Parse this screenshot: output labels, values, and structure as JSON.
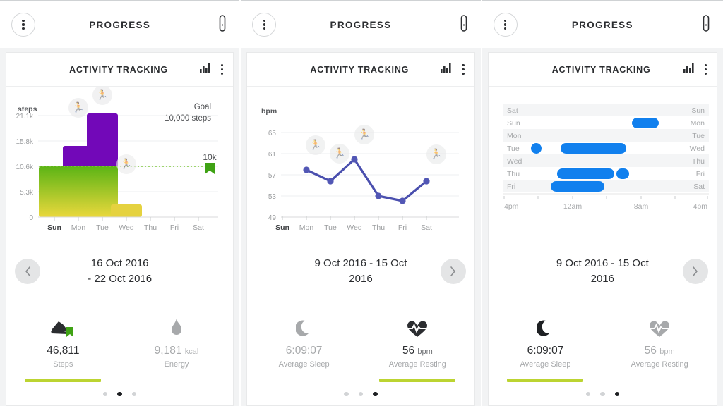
{
  "appbar": {
    "title": "PROGRESS",
    "menu_icon": "kebab-menu-icon",
    "band_icon": "fitness-band-icon"
  },
  "card": {
    "title": "ACTIVITY TRACKING",
    "chart_icon": "bar-chart-icon",
    "overflow_icon": "kebab-menu-icon"
  },
  "screens": [
    {
      "id": "steps",
      "date_range": "16 Oct 2016\n- 22 Oct 2016",
      "date_range_line1": "16 Oct 2016",
      "date_range_line2": "- 22 Oct 2016",
      "nav": {
        "prev_label": "‹",
        "show_prev": true,
        "show_next": false
      },
      "stats": [
        {
          "icon": "shoe-icon",
          "value": "46,811",
          "unit": "",
          "label": "Steps",
          "active": true,
          "goal_flag": true
        },
        {
          "icon": "flame-icon",
          "value": "9,181",
          "unit": "kcal",
          "label": "Energy",
          "active": false
        }
      ],
      "page_dots": [
        false,
        true,
        false
      ]
    },
    {
      "id": "heart-rate",
      "date_range_line1": "9 Oct 2016 - 15 Oct",
      "date_range_line2": "2016",
      "nav": {
        "next_label": "›",
        "show_prev": false,
        "show_next": true
      },
      "stats": [
        {
          "icon": "moon-icon",
          "value": "6:09:07",
          "unit": "",
          "label": "Average Sleep",
          "active": false
        },
        {
          "icon": "heart-pulse-icon",
          "value": "56",
          "unit": "bpm",
          "label": "Average Resting",
          "active": true
        }
      ],
      "page_dots": [
        false,
        false,
        true
      ]
    },
    {
      "id": "sleep",
      "date_range_line1": "9 Oct 2016 - 15 Oct",
      "date_range_line2": "2016",
      "nav": {
        "next_label": "›",
        "show_prev": false,
        "show_next": true
      },
      "stats": [
        {
          "icon": "moon-icon",
          "value": "6:09:07",
          "unit": "",
          "label": "Average Sleep",
          "active": true
        },
        {
          "icon": "heart-pulse-icon",
          "value": "56",
          "unit": "bpm",
          "label": "Average Resting",
          "active": false
        }
      ],
      "page_dots": [
        false,
        false,
        true
      ]
    }
  ],
  "chart_data": [
    {
      "type": "bar",
      "id": "steps-chart",
      "title": "",
      "ylabel": "steps",
      "xlabel": "",
      "categories": [
        "Sun",
        "Mon",
        "Tue",
        "Wed",
        "Thu",
        "Fri",
        "Sat"
      ],
      "values": [
        10400,
        13100,
        20100,
        2600,
        0,
        0,
        0
      ],
      "ytick_labels": [
        "0",
        "5.3k",
        "10.6k",
        "15.8k",
        "21.1k"
      ],
      "ytick_values": [
        0,
        5300,
        10600,
        15800,
        21100
      ],
      "ylim": [
        0,
        23000
      ],
      "grid": true,
      "bold_category": "Sun",
      "goal": {
        "value": 10000,
        "label": "10k",
        "title": "Goal",
        "subtitle": "10,000 steps",
        "color": "#3fa214"
      },
      "bar_color_top": "#5cb415",
      "bar_color_bottom": "#e8d93d",
      "over_goal_color": "#7208b8",
      "annotations": [
        {
          "icon": "running-pin-icon",
          "category": "Sun",
          "x_frac": 0.3,
          "y_value": 15500
        },
        {
          "icon": "running-pin-icon",
          "category": "Mon",
          "x_frac": 0.45,
          "y_value": 21500
        },
        {
          "icon": "running-pin-icon",
          "category": "Wed",
          "x_frac": 0.52,
          "y_value": 10800
        }
      ]
    },
    {
      "type": "line",
      "id": "heart-rate-chart",
      "title": "",
      "ylabel": "bpm",
      "xlabel": "",
      "categories": [
        "Sun",
        "Mon",
        "Tue",
        "Wed",
        "Thu",
        "Fri",
        "Sat"
      ],
      "values": [
        null,
        58,
        56,
        60,
        53,
        52,
        56
      ],
      "ytick_labels": [
        "49",
        "53",
        "57",
        "61",
        "65"
      ],
      "ytick_values": [
        49,
        53,
        57,
        61,
        65
      ],
      "ylim": [
        49,
        67
      ],
      "grid": true,
      "bold_category": "Sun",
      "line_color": "#4a4fae",
      "marker_color": "#5257b5",
      "annotations": [
        {
          "icon": "running-pin-icon",
          "category": "Mon",
          "y_value": 64
        },
        {
          "icon": "running-pin-icon",
          "category": "Tue",
          "y_value": 62.5
        },
        {
          "icon": "running-pin-icon",
          "category": "Wed",
          "y_value": 65.5
        },
        {
          "icon": "running-pin-icon",
          "category": "Sat",
          "y_value": 62.5
        }
      ]
    },
    {
      "type": "timeline",
      "id": "sleep-chart",
      "title": "",
      "xlabel": "",
      "ylabel": "",
      "row_labels_left": [
        "Sat",
        "Sun",
        "Mon",
        "Tue",
        "Wed",
        "Thu",
        "Fri"
      ],
      "row_labels_right": [
        "Sun",
        "Mon",
        "Tue",
        "Wed",
        "Thu",
        "Fri",
        "Sat"
      ],
      "xtick_labels": [
        "4pm",
        "",
        "12am",
        "",
        "8am",
        "",
        "4pm"
      ],
      "xtick_positions": [
        0,
        0.1667,
        0.3333,
        0.5,
        0.6667,
        0.8333,
        1
      ],
      "xlim_hours": [
        16,
        40
      ],
      "bar_color": "#1180ee",
      "sessions": [
        {
          "row": 0,
          "segments": []
        },
        {
          "row": 1,
          "segments": [
            {
              "start_frac": 0.625,
              "end_frac": 0.755
            }
          ]
        },
        {
          "row": 2,
          "segments": []
        },
        {
          "row": 3,
          "segments": [
            {
              "start_frac": 0.138,
              "end_frac": 0.178
            },
            {
              "start_frac": 0.283,
              "end_frac": 0.6
            }
          ]
        },
        {
          "row": 4,
          "segments": []
        },
        {
          "row": 5,
          "segments": [
            {
              "start_frac": 0.265,
              "end_frac": 0.543
            },
            {
              "start_frac": 0.552,
              "end_frac": 0.612
            }
          ]
        },
        {
          "row": 6,
          "segments": [
            {
              "start_frac": 0.232,
              "end_frac": 0.492
            }
          ]
        }
      ]
    }
  ]
}
